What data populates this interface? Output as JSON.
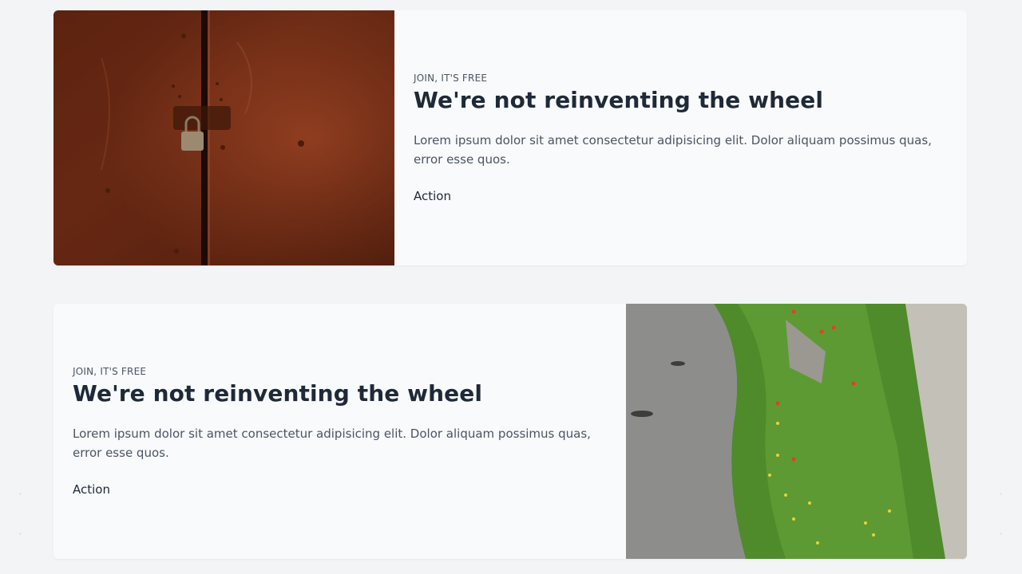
{
  "cards": [
    {
      "eyebrow": "Join, it's free",
      "title": "We're not reinventing the wheel",
      "description": "Lorem ipsum dolor sit amet consectetur adipisicing elit. Dolor aliquam possimus quas, error esse quos.",
      "action_label": "Action",
      "image": "rusty-red-door-with-padlock"
    },
    {
      "eyebrow": "Join, it's free",
      "title": "We're not reinventing the wheel",
      "description": "Lorem ipsum dolor sit amet consectetur adipisicing elit. Dolor aliquam possimus quas, error esse quos.",
      "action_label": "Action",
      "image": "road-with-grass-and-flowers"
    }
  ],
  "colors": {
    "page_bg": "#f3f4f6",
    "card_bg": "#f8fafc",
    "title": "#1f2937",
    "text": "#4b5563"
  }
}
